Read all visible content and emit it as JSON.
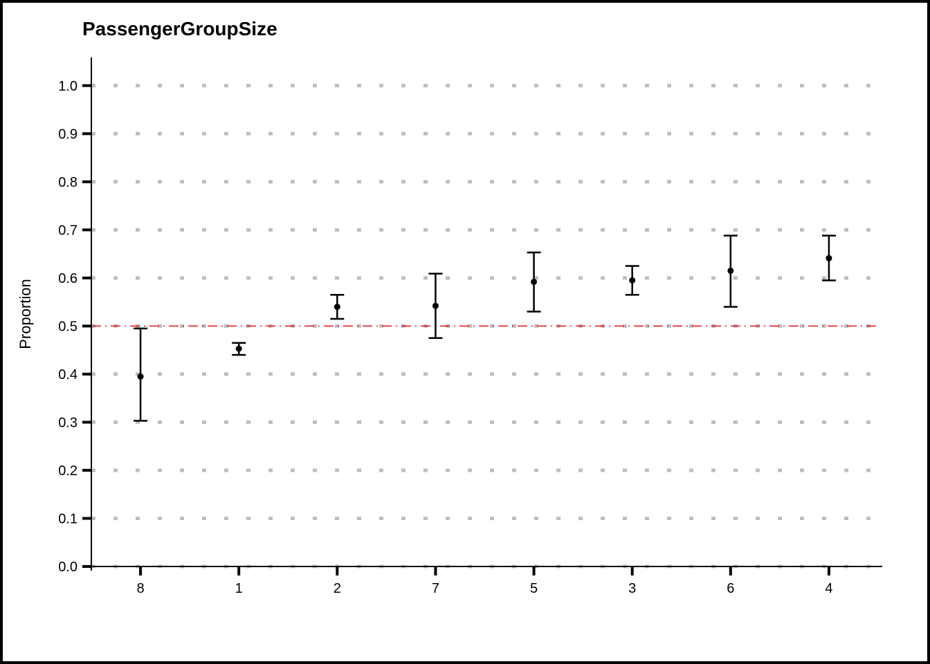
{
  "chart_data": {
    "type": "errorbar",
    "title": "PassengerGroupSize",
    "ylabel": "Proportion",
    "xlabel": "",
    "categories": [
      "8",
      "1",
      "2",
      "7",
      "5",
      "3",
      "6",
      "4"
    ],
    "series": [
      {
        "name": "proportion",
        "values": [
          0.395,
          0.453,
          0.54,
          0.542,
          0.592,
          0.595,
          0.615,
          0.641
        ],
        "err_low": [
          0.303,
          0.44,
          0.515,
          0.475,
          0.53,
          0.565,
          0.54,
          0.595
        ],
        "err_high": [
          0.495,
          0.465,
          0.565,
          0.609,
          0.653,
          0.625,
          0.688,
          0.688
        ]
      }
    ],
    "reference_line": 0.5,
    "ylim": [
      0.0,
      1.05
    ],
    "yticks": [
      0.0,
      0.1,
      0.2,
      0.3,
      0.4,
      0.5,
      0.6,
      0.7,
      0.8,
      0.9,
      1.0
    ],
    "grid": true
  }
}
